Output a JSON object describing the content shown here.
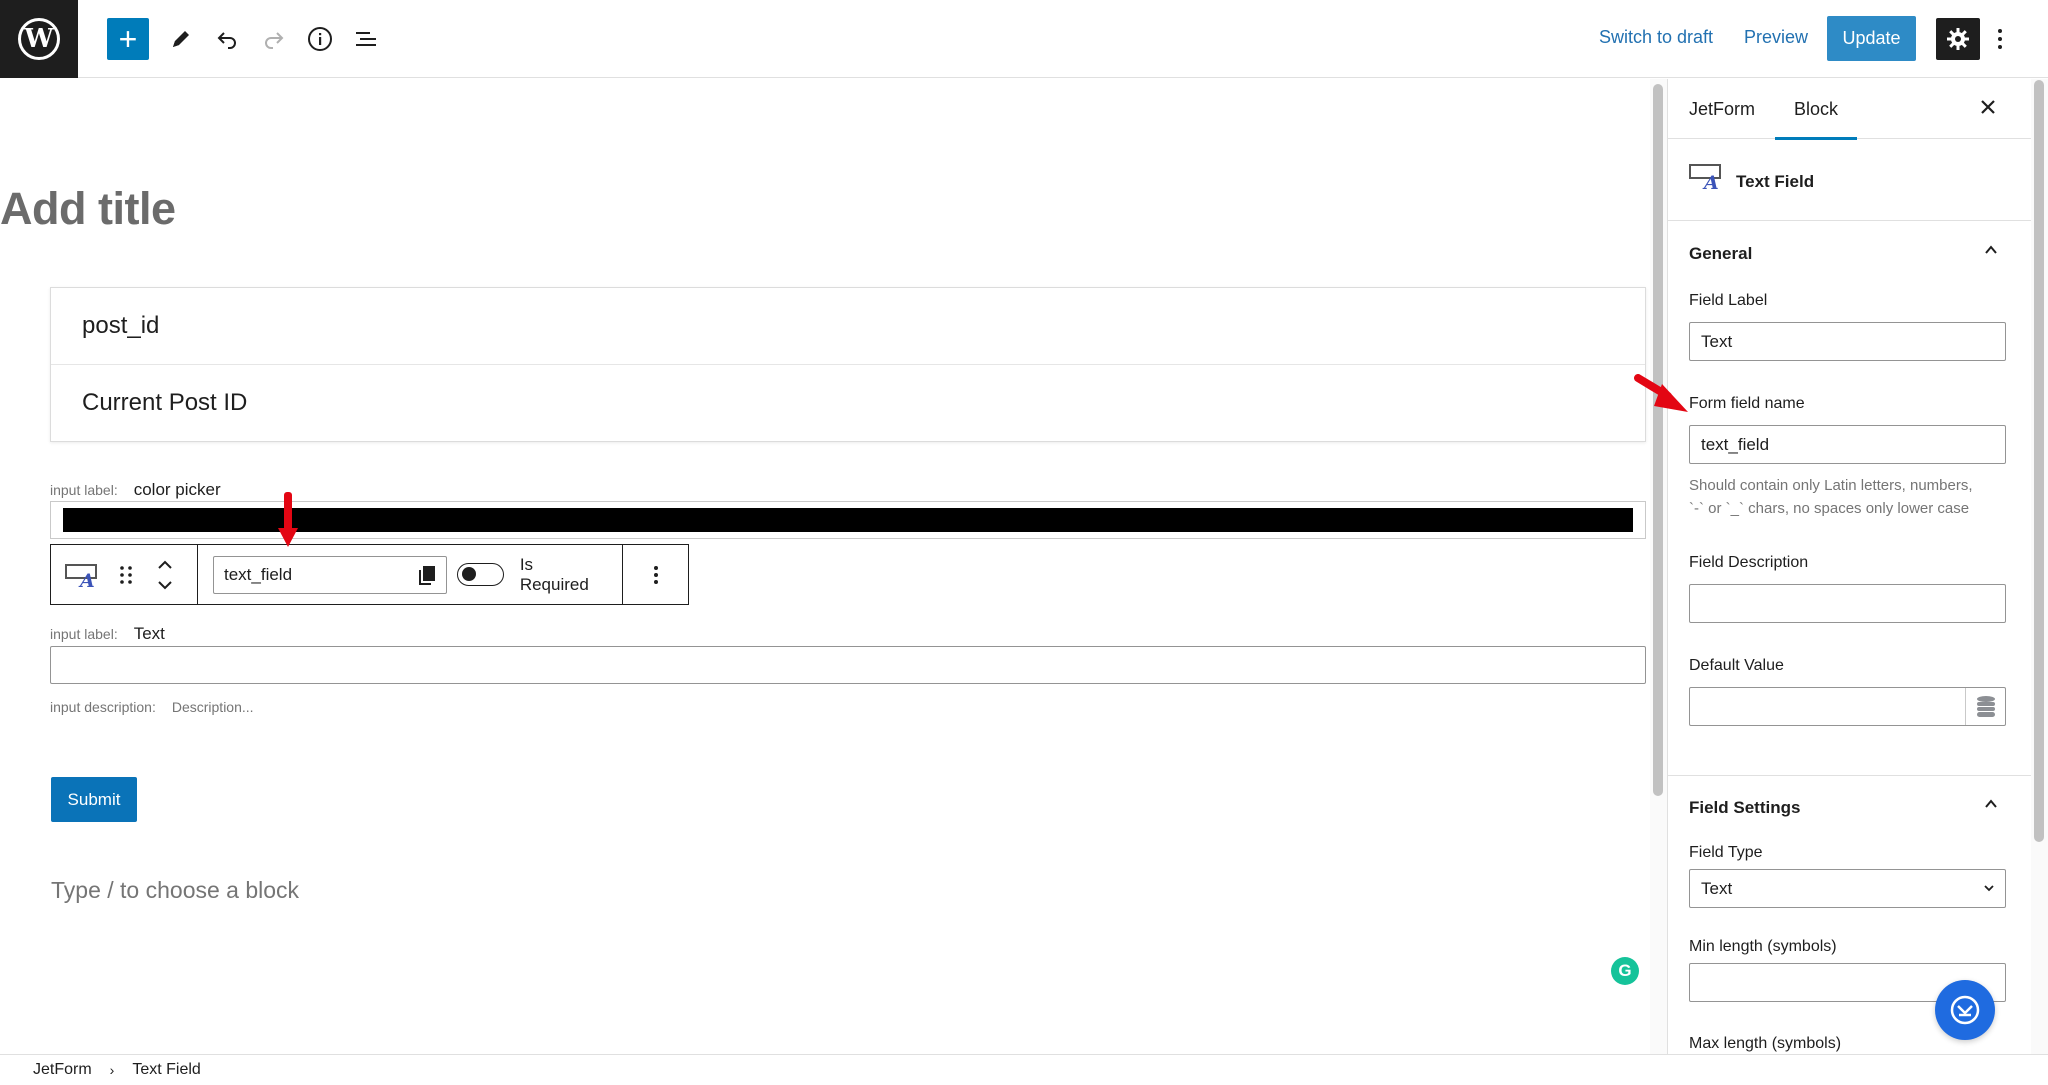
{
  "toolbar": {
    "switch_to_draft": "Switch to draft",
    "preview": "Preview",
    "update": "Update"
  },
  "editor": {
    "title_placeholder": "Add title",
    "card_rows": [
      "post_id",
      "Current Post ID"
    ],
    "color_field": {
      "label_prefix": "input label:",
      "label": "color picker"
    },
    "block_toolbar": {
      "field_name": "text_field",
      "required_label": "Is Required"
    },
    "text_field": {
      "label_prefix": "input label:",
      "label": "Text",
      "description_prefix": "input description:",
      "description": "Description..."
    },
    "submit_label": "Submit",
    "appender_placeholder": "Type / to choose a block"
  },
  "sidebar": {
    "tabs": [
      "JetForm",
      "Block"
    ],
    "active_tab": "Block",
    "block_name": "Text Field",
    "general": {
      "heading": "General",
      "field_label_label": "Field Label",
      "field_label_value": "Text",
      "form_field_name_label": "Form field name",
      "form_field_name_value": "text_field",
      "form_field_name_help_1": "Should contain only Latin letters, numbers,",
      "form_field_name_help_2": "`-` or `_` chars, no spaces only lower case",
      "field_description_label": "Field Description",
      "field_description_value": "",
      "default_value_label": "Default Value",
      "default_value_value": ""
    },
    "field_settings": {
      "heading": "Field Settings",
      "field_type_label": "Field Type",
      "field_type_value": "Text",
      "min_length_label": "Min length (symbols)",
      "max_length_label": "Max length (symbols)"
    }
  },
  "breadcrumb": [
    "JetForm",
    "Text Field"
  ],
  "colors": {
    "accent": "#007cba",
    "update_button": "#2e8bc6",
    "annotation_arrow": "#e30613",
    "grammarly": "#15c39a",
    "chat_button": "#1f6be0"
  },
  "icons": [
    "wordpress-logo-icon",
    "plus-icon",
    "pencil-icon",
    "undo-icon",
    "redo-icon",
    "info-icon",
    "list-view-icon",
    "gear-icon",
    "kebab-icon",
    "text-field-block-icon",
    "drag-handle-icon",
    "move-up-icon",
    "move-down-icon",
    "copy-icon",
    "close-icon",
    "chevron-up-icon",
    "chevron-down-icon",
    "database-icon",
    "grammarly-icon",
    "chat-icon"
  ]
}
